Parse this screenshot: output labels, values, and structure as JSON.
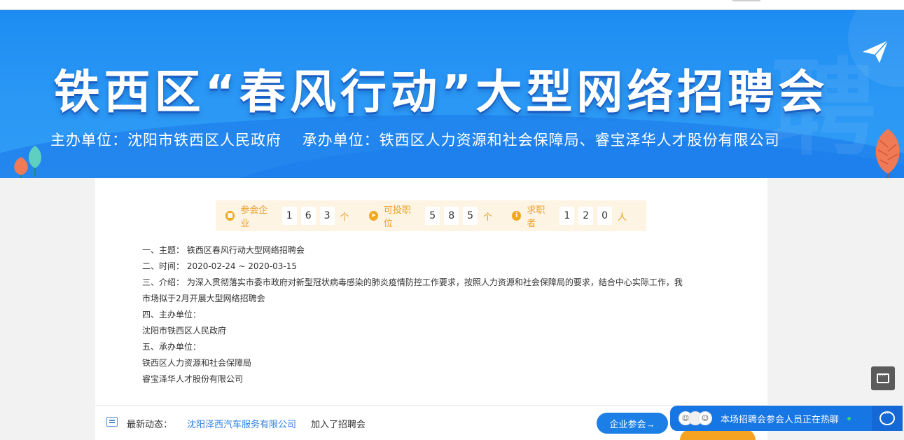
{
  "banner": {
    "title": "铁西区“春风行动”大型网络招聘会",
    "organizer_label": "主办单位：沈阳市铁西区人民政府",
    "contractor_label": "承办单位：铁西区人力资源和社会保障局、睿宝泽华人才股份有限公司",
    "watermark_char": "聘"
  },
  "stats": {
    "companies": {
      "icon": "building-icon",
      "label": "参会企业",
      "digits": [
        "1",
        "6",
        "3"
      ],
      "unit": "个"
    },
    "positions": {
      "icon": "send-icon",
      "label": "可投职位",
      "digits": [
        "5",
        "8",
        "5"
      ],
      "unit": "个"
    },
    "seekers": {
      "icon": "person-icon",
      "label": "求职者",
      "digits": [
        "1",
        "2",
        "0"
      ],
      "unit": "人"
    }
  },
  "description": {
    "line1": "一、主题：  铁西区春风行动大型网络招聘会",
    "line2": "二、时间：  2020-02-24 ~ 2020-03-15",
    "line3": "三、介绍：  为深入贯彻落实市委市政府对新型冠状病毒感染的肺炎疫情防控工作要求，按照人力资源和社会保障局的要求，结合中心实际工作，我",
    "line4": "市场拟于2月开展大型网络招聘会",
    "line5": "四、主办单位：",
    "line6": "沈阳市铁西区人民政府",
    "line7": "五、承办单位：",
    "line8": "铁西区人力资源和社会保障局",
    "line9": "睿宝泽华人才股份有限公司"
  },
  "ticker": {
    "label": "最新动态：",
    "company": "沈阳泽西汽车服务有限公司",
    "action": "加入了招聘会",
    "join_button": "企业参会→"
  },
  "chat": {
    "text": "本场招聘会参会人员正在热聊"
  },
  "colors": {
    "banner_blue": "#1d8cf2",
    "accent_orange": "#f2a81d",
    "link_blue": "#2d7fe0",
    "button_blue": "#1b7fe6"
  }
}
